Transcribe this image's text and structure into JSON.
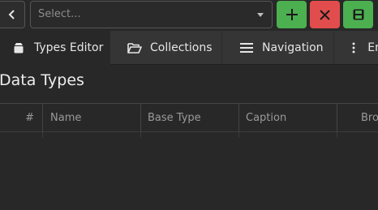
{
  "toolbar": {
    "select_placeholder": "Select...",
    "icons": {
      "back": "chevron-left-icon",
      "add": "plus-icon",
      "delete": "close-icon",
      "save": "save-icon"
    },
    "colors": {
      "add": "#4caf50",
      "delete": "#e14d4d",
      "save": "#4caf50"
    }
  },
  "tabs": [
    {
      "label": "Types Editor",
      "icon": "box-icon",
      "active": true
    },
    {
      "label": "Collections",
      "icon": "folder-open-icon",
      "active": false
    },
    {
      "label": "Navigation",
      "icon": "menu-icon",
      "active": false
    },
    {
      "label": "En",
      "icon": "kebab-icon",
      "active": false
    }
  ],
  "page": {
    "title": "Data Types"
  },
  "table": {
    "columns": [
      "#",
      "Name",
      "Base Type",
      "Caption",
      "Bro"
    ]
  }
}
